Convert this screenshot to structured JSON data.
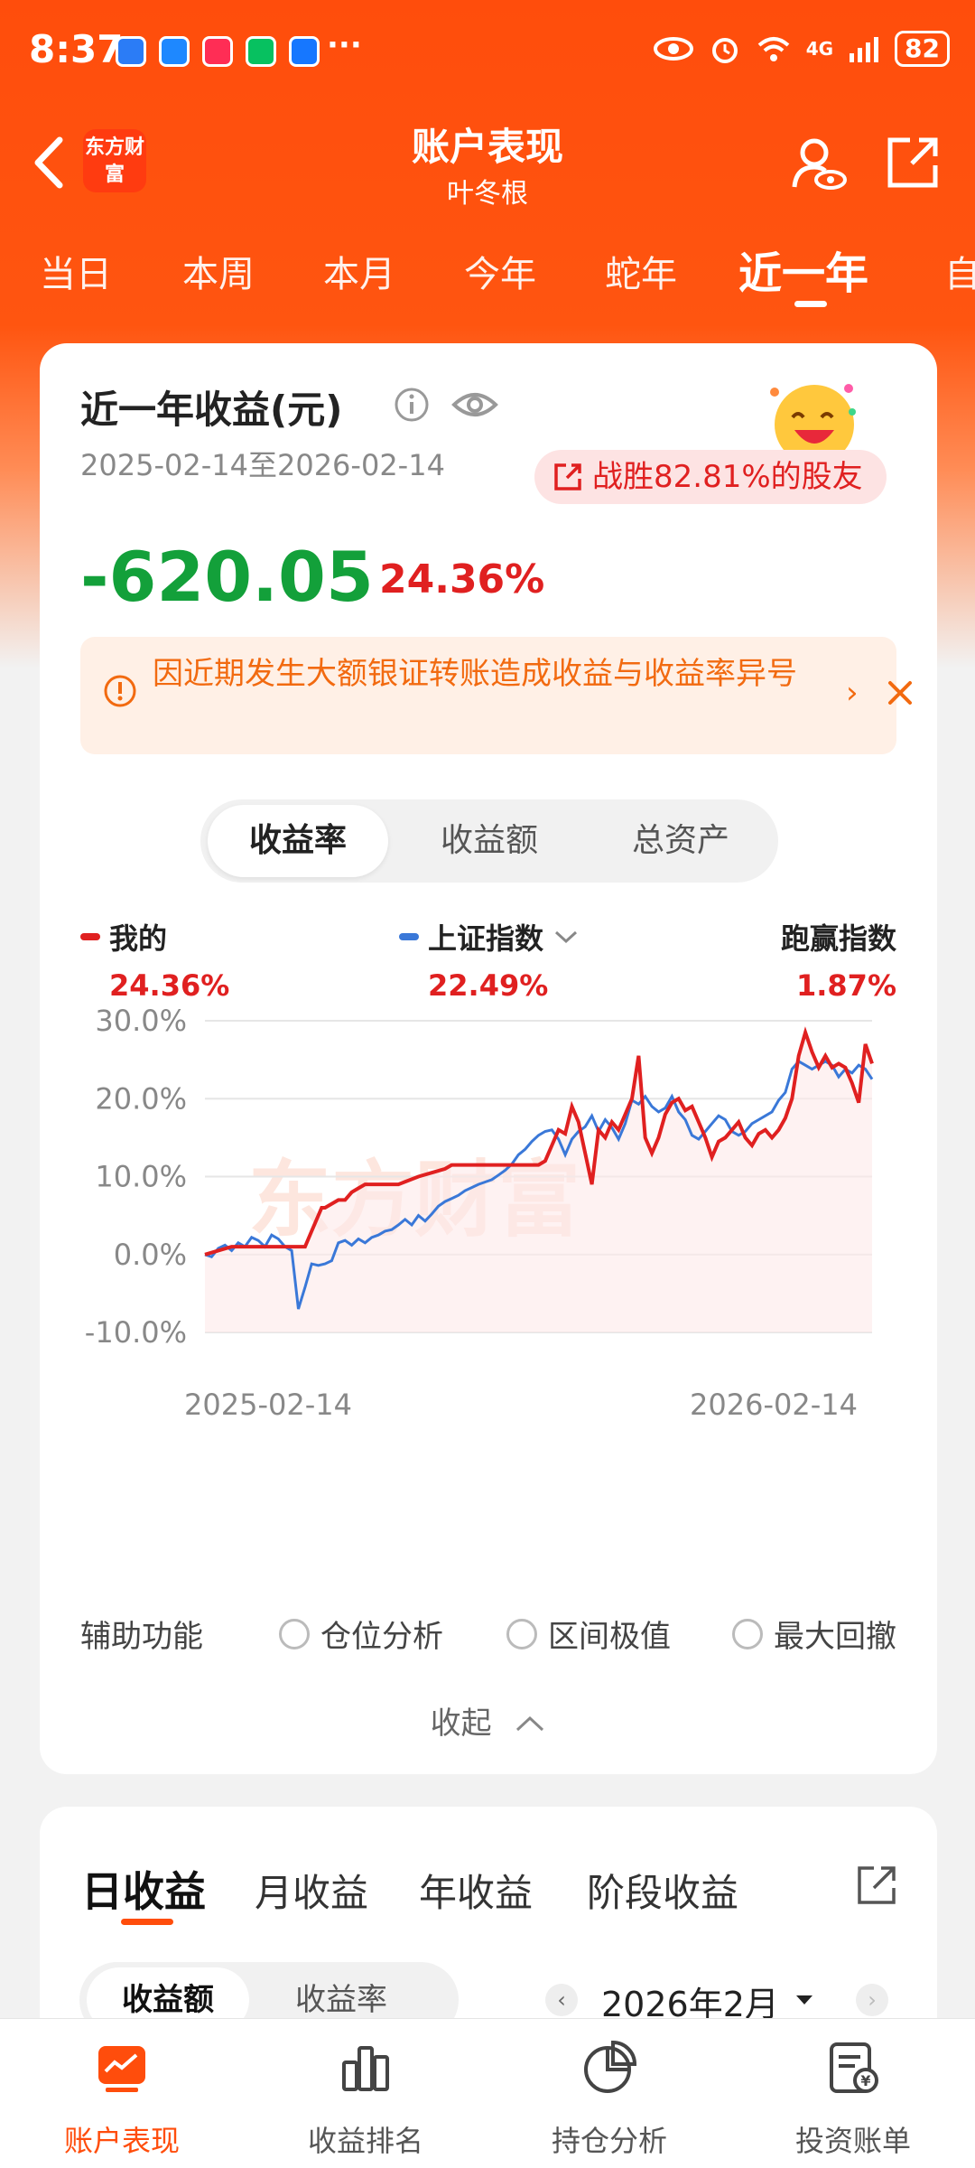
{
  "status_bar": {
    "time": "8:37",
    "more": "···",
    "network": "4G",
    "battery": "82"
  },
  "header": {
    "title": "账户表现",
    "subtitle": "叶冬根",
    "logo_text": "东方财富"
  },
  "period_tabs": [
    {
      "label": "当日",
      "active": false
    },
    {
      "label": "本周",
      "active": false
    },
    {
      "label": "本月",
      "active": false
    },
    {
      "label": "今年",
      "active": false
    },
    {
      "label": "蛇年",
      "active": false
    },
    {
      "label": "近一年",
      "active": true
    },
    {
      "label": "自",
      "active": false
    }
  ],
  "summary": {
    "title": "近一年收益(元)",
    "date_range": "2025-02-14至2026-02-14",
    "beat_text": "战胜82.81%的股友",
    "profit": "-620.05",
    "rate": "24.36%",
    "notice": "因近期发生大额银证转账造成收益与收益率异号",
    "colors": {
      "loss": "#13a03a",
      "gain": "#e02020",
      "brand": "#ff4d0c"
    }
  },
  "metric_tabs": [
    {
      "label": "收益率",
      "active": true
    },
    {
      "label": "收益额",
      "active": false
    },
    {
      "label": "总资产",
      "active": false
    }
  ],
  "legend": {
    "mine": {
      "label": "我的",
      "value": "24.36%",
      "color": "#e02020"
    },
    "index": {
      "label": "上证指数",
      "value": "22.49%",
      "color": "#3a78d8"
    },
    "excess": {
      "label": "跑赢指数",
      "value": "1.87%"
    }
  },
  "chart_data": {
    "type": "line",
    "ylim": [
      -10,
      30
    ],
    "yticks": [
      "30.0%",
      "20.0%",
      "10.0%",
      "0.0%",
      "-10.0%"
    ],
    "xlabels": [
      "2025-02-14",
      "2026-02-14"
    ],
    "watermark": "东方财富",
    "series": [
      {
        "name": "我的",
        "color": "#e02020",
        "x": [
          0,
          2,
          4,
          5,
          7,
          9,
          11,
          12,
          14,
          15,
          16,
          17,
          17.5,
          18,
          20,
          21,
          22,
          23,
          24,
          26,
          29,
          32,
          34,
          36,
          37,
          38,
          39,
          40,
          41,
          42,
          43,
          44,
          45,
          46,
          47,
          48,
          49,
          50,
          51,
          52,
          53,
          54,
          55,
          56,
          57,
          58,
          59,
          60,
          61,
          62,
          63,
          64,
          65,
          66,
          67,
          68,
          69,
          70,
          71,
          72,
          73,
          74,
          75,
          76,
          77,
          78,
          79,
          80,
          81,
          82,
          83,
          84,
          85,
          86,
          87,
          88,
          89,
          90,
          91,
          92,
          93,
          94,
          95,
          96,
          97,
          98,
          99,
          100
        ],
        "values": [
          0,
          0.5,
          1,
          1,
          1,
          1,
          1,
          1,
          1,
          1,
          3,
          5,
          6,
          6,
          7,
          7,
          8,
          8.5,
          9,
          9,
          9,
          10,
          10.5,
          11,
          11.5,
          11.5,
          11.5,
          11.5,
          11.5,
          11.5,
          11.5,
          11.5,
          11.5,
          11.5,
          11.5,
          11.5,
          11.5,
          11.5,
          12,
          14,
          16,
          15.5,
          19,
          17,
          13,
          9,
          16,
          15,
          17,
          16,
          18,
          20,
          25.5,
          15,
          13,
          15,
          18,
          19.5,
          20,
          18.5,
          19,
          17,
          15,
          12.5,
          14.5,
          15,
          16,
          17,
          15,
          14,
          15.5,
          16,
          15,
          16,
          17.5,
          20,
          25.5,
          28.5,
          26,
          24,
          25.5,
          24,
          24.5,
          24,
          22,
          19.5,
          27,
          24.5
        ]
      },
      {
        "name": "上证指数",
        "color": "#3a78d8",
        "x": [
          0,
          1,
          2,
          3,
          4,
          5,
          6,
          7,
          8,
          9,
          10,
          11,
          12,
          13,
          14,
          15,
          16,
          17,
          18,
          19,
          20,
          21,
          22,
          23,
          24,
          25,
          26,
          27,
          28,
          29,
          30,
          31,
          32,
          33,
          34,
          35,
          36,
          37,
          38,
          39,
          40,
          41,
          42,
          43,
          44,
          45,
          46,
          47,
          48,
          49,
          50,
          51,
          52,
          53,
          54,
          55,
          56,
          57,
          58,
          59,
          60,
          61,
          62,
          63,
          64,
          65,
          66,
          67,
          68,
          69,
          70,
          71,
          72,
          73,
          74,
          75,
          76,
          77,
          78,
          79,
          80,
          81,
          82,
          83,
          84,
          85,
          86,
          87,
          88,
          89,
          90,
          91,
          92,
          93,
          94,
          95,
          96,
          97,
          98,
          99,
          100
        ],
        "values": [
          0,
          -0.3,
          0.8,
          1.2,
          0.5,
          1.5,
          1,
          2.2,
          1.8,
          1,
          2.5,
          2,
          1,
          0.5,
          -7,
          -4.2,
          -1.2,
          -1.4,
          -1.2,
          -0.8,
          1.5,
          1.8,
          1.2,
          2,
          1.5,
          2.2,
          2.5,
          3,
          3.2,
          3.8,
          4.5,
          3.8,
          5,
          4.3,
          5.2,
          6.2,
          6.8,
          7.2,
          7.6,
          8.2,
          8.6,
          9,
          9.3,
          9.6,
          10.2,
          10.8,
          11.6,
          12.8,
          13.5,
          14.5,
          15.3,
          15.8,
          16,
          14.8,
          12.8,
          14.8,
          15.8,
          16.4,
          17.8,
          15.8,
          17.3,
          16.3,
          14.8,
          16.8,
          19.8,
          19.3,
          20.3,
          19,
          18.3,
          18.8,
          20.3,
          18.3,
          17.3,
          15.3,
          14.8,
          15.8,
          16.8,
          17.8,
          17.3,
          15.8,
          15.3,
          15.8,
          16.8,
          17.3,
          17.8,
          18.3,
          19.8,
          20.8,
          23.8,
          24.8,
          24.3,
          23.8,
          24.3,
          24.8,
          24.3,
          22.8,
          23.8,
          23.3,
          24.3,
          23.8,
          22.5
        ]
      }
    ]
  },
  "aux": {
    "label": "辅助功能",
    "options": [
      "仓位分析",
      "区间极值",
      "最大回撤"
    ],
    "collapse": "收起"
  },
  "profit_section": {
    "tabs": [
      {
        "label": "日收益",
        "active": true
      },
      {
        "label": "月收益",
        "active": false
      },
      {
        "label": "年收益",
        "active": false
      },
      {
        "label": "阶段收益",
        "active": false
      }
    ],
    "sub_tabs": [
      {
        "label": "收益额",
        "active": true
      },
      {
        "label": "收益率",
        "active": false
      }
    ],
    "month": "2026年2月"
  },
  "bottom_nav": [
    {
      "label": "账户表现",
      "icon": "chart-card-icon",
      "active": true
    },
    {
      "label": "收益排名",
      "icon": "bar-chart-icon",
      "active": false
    },
    {
      "label": "持仓分析",
      "icon": "pie-chart-icon",
      "active": false
    },
    {
      "label": "投资账单",
      "icon": "bill-icon",
      "active": false
    }
  ]
}
